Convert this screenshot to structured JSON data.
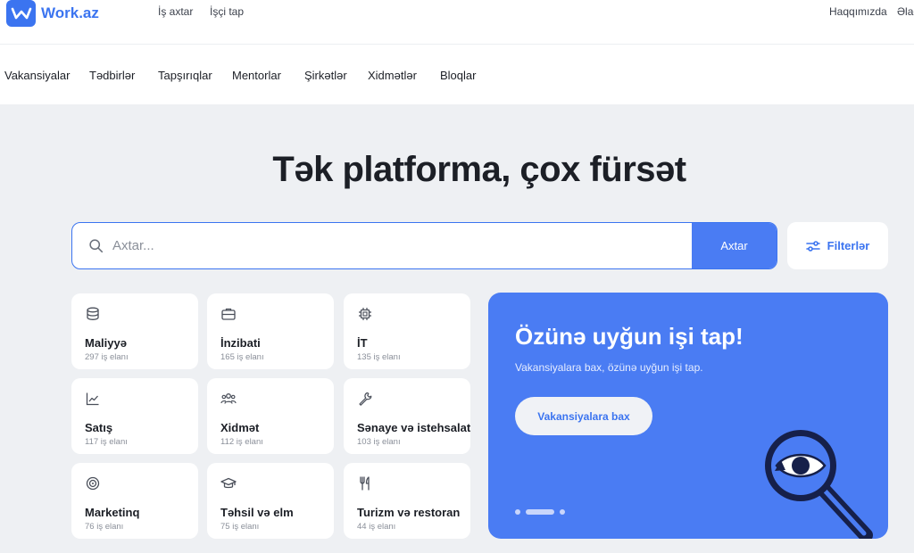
{
  "brand": {
    "name": "Work.az"
  },
  "topbar": {
    "links": [
      "İş axtar",
      "İşçi tap"
    ],
    "right_links": [
      "Haqqımızda",
      "Əlaq"
    ]
  },
  "nav": {
    "items": [
      "Vakansiyalar",
      "Tədbirlər",
      "Tapşırıqlar",
      "Mentorlar",
      "Şirkətlər",
      "Xidmətlər",
      "Bloqlar"
    ]
  },
  "hero": {
    "headline": "Tək platforma, çox fürsət"
  },
  "search": {
    "placeholder": "Axtar...",
    "button_label": "Axtar"
  },
  "filters": {
    "label": "Filterlər"
  },
  "categories": [
    {
      "title": "Maliyyə",
      "count": "297 iş elanı",
      "icon": "coins-icon"
    },
    {
      "title": "İnzibati",
      "count": "165 iş elanı",
      "icon": "briefcase-icon"
    },
    {
      "title": "İT",
      "count": "135 iş elanı",
      "icon": "chip-icon"
    },
    {
      "title": "Satış",
      "count": "117 iş elanı",
      "icon": "chart-icon"
    },
    {
      "title": "Xidmət",
      "count": "112 iş elanı",
      "icon": "people-icon"
    },
    {
      "title": "Sənaye və istehsalat",
      "count": "103 iş elanı",
      "icon": "wrench-icon"
    },
    {
      "title": "Marketinq",
      "count": "76 iş elanı",
      "icon": "target-icon"
    },
    {
      "title": "Təhsil və elm",
      "count": "75 iş elanı",
      "icon": "graduation-cap-icon"
    },
    {
      "title": "Turizm və restoran",
      "count": "44 iş elanı",
      "icon": "utensils-icon"
    }
  ],
  "promo": {
    "title": "Özünə uyğun işi tap!",
    "subtitle": "Vakansiyalara bax, özünə uyğun işi tap.",
    "button_label": "Vakansiyalara bax",
    "slide_index": 1,
    "slide_count": 3
  },
  "colors": {
    "accent": "#3b74f0",
    "promo_bg": "#4a7cf3",
    "page_bg": "#eef0f3"
  }
}
